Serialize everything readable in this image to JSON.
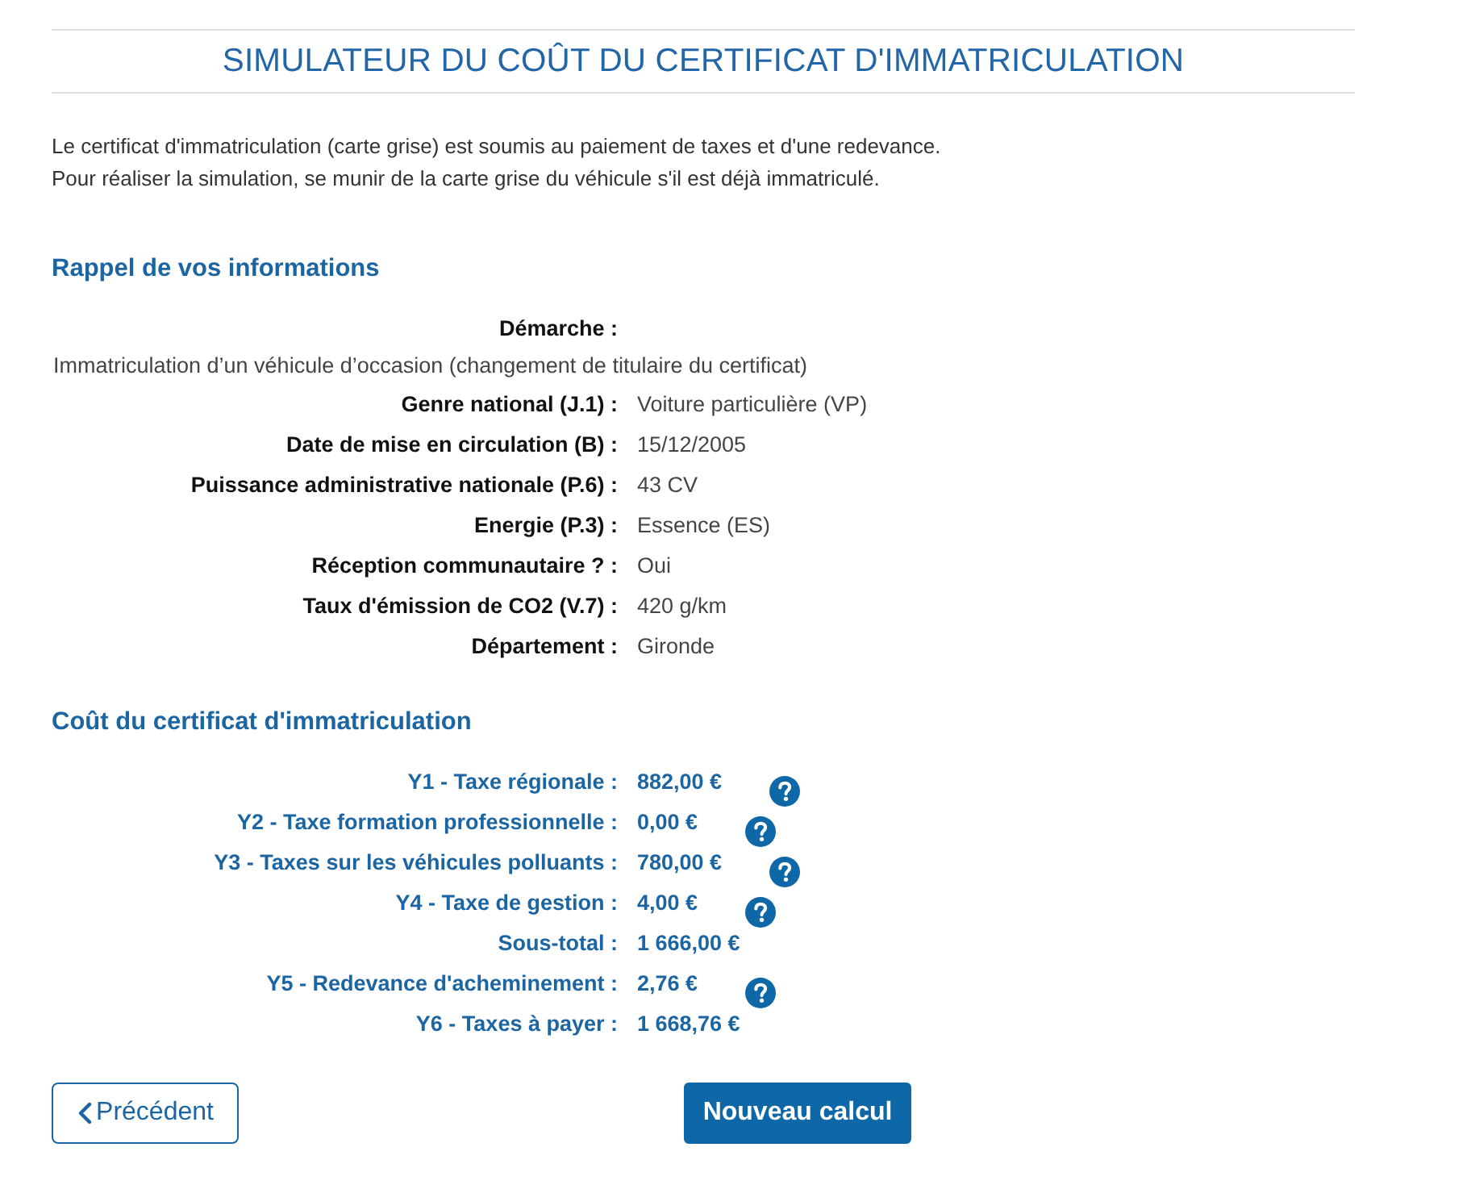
{
  "title": "SIMULATEUR DU COÛT DU CERTIFICAT D'IMMATRICULATION",
  "intro": [
    "Le certificat d'immatriculation (carte grise) est soumis au paiement de taxes et d'une redevance.",
    "Pour réaliser la simulation, se munir de la carte grise du véhicule s'il est déjà immatriculé."
  ],
  "info": {
    "heading": "Rappel de vos informations",
    "rows": [
      {
        "kind": "stacked",
        "label": "Démarche :",
        "value": "Immatriculation d’un véhicule d’occasion (changement de titulaire du certificat)"
      },
      {
        "kind": "inline",
        "label": "Genre national (J.1) :",
        "value": "Voiture particulière (VP)"
      },
      {
        "kind": "inline",
        "label": "Date de mise en circulation (B) :",
        "value": "15/12/2005"
      },
      {
        "kind": "inline",
        "label": "Puissance administrative nationale (P.6) :",
        "value": "43 CV"
      },
      {
        "kind": "inline",
        "label": "Energie (P.3) :",
        "value": "Essence (ES)"
      },
      {
        "kind": "inline",
        "label": "Réception communautaire ? :",
        "value": "Oui"
      },
      {
        "kind": "inline",
        "label": "Taux d'émission de CO2 (V.7) :",
        "value": "420 g/km"
      },
      {
        "kind": "inline",
        "label": "Département :",
        "value": "Gironde"
      }
    ]
  },
  "cost": {
    "heading": "Coût du certificat d'immatriculation",
    "rows": [
      {
        "label": "Y1 - Taxe régionale :",
        "value": "882,00 €",
        "help": true
      },
      {
        "label": "Y2 - Taxe formation professionnelle :",
        "value": "0,00 €",
        "help": true
      },
      {
        "label": "Y3 - Taxes sur les véhicules polluants :",
        "value": "780,00 €",
        "help": true
      },
      {
        "label": "Y4 - Taxe de gestion :",
        "value": "4,00 €",
        "help": true
      },
      {
        "label": "Sous-total :",
        "value": "1 666,00 €",
        "help": false
      },
      {
        "label": "Y5 - Redevance d'acheminement :",
        "value": "2,76 €",
        "help": true
      },
      {
        "label": "Y6 - Taxes à payer :",
        "value": "1 668,76 €",
        "help": false
      }
    ]
  },
  "buttons": {
    "previous": "Précédent",
    "new": "Nouveau calcul"
  }
}
